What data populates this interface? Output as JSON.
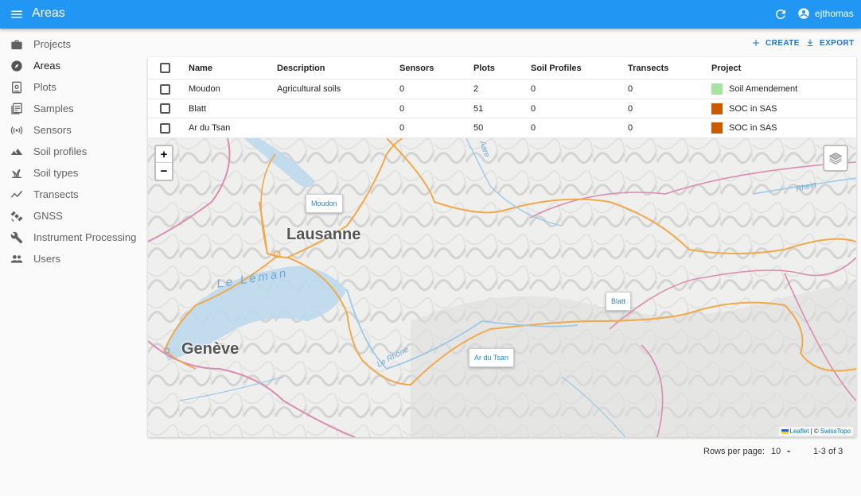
{
  "app": {
    "title": "Areas",
    "username": "ejthomas"
  },
  "sidebar": {
    "items": [
      {
        "label": "Projects",
        "icon": "briefcase-icon"
      },
      {
        "label": "Areas",
        "icon": "compass-icon",
        "active": true
      },
      {
        "label": "Plots",
        "icon": "plot-icon"
      },
      {
        "label": "Samples",
        "icon": "samples-icon"
      },
      {
        "label": "Sensors",
        "icon": "sensor-icon"
      },
      {
        "label": "Soil profiles",
        "icon": "terrain-icon"
      },
      {
        "label": "Soil types",
        "icon": "grass-icon"
      },
      {
        "label": "Transects",
        "icon": "timeline-icon"
      },
      {
        "label": "GNSS",
        "icon": "satellite-icon"
      },
      {
        "label": "Instrument Processing",
        "icon": "wrench-icon"
      },
      {
        "label": "Users",
        "icon": "people-icon"
      }
    ]
  },
  "toolbar": {
    "create_label": "CREATE",
    "export_label": "EXPORT"
  },
  "table": {
    "columns": [
      "Name",
      "Description",
      "Sensors",
      "Plots",
      "Soil Profiles",
      "Transects",
      "Project"
    ],
    "rows": [
      {
        "name": "Moudon",
        "description": "Agricultural soils",
        "sensors": "0",
        "plots": "2",
        "soil_profiles": "0",
        "transects": "0",
        "project": "Soil Amendement",
        "project_color": "#a5e3a0"
      },
      {
        "name": "Blatt",
        "description": "",
        "sensors": "0",
        "plots": "51",
        "soil_profiles": "0",
        "transects": "0",
        "project": "SOC in SAS",
        "project_color": "#c95a00"
      },
      {
        "name": "Ar du Tsan",
        "description": "",
        "sensors": "0",
        "plots": "50",
        "soil_profiles": "0",
        "transects": "0",
        "project": "SOC in SAS",
        "project_color": "#c95a00"
      }
    ]
  },
  "map": {
    "zoom_in": "+",
    "zoom_out": "−",
    "cities": [
      "Lausanne",
      "Genève"
    ],
    "lake": "Le Léman",
    "rivers": [
      "Le Rhône",
      "Aare",
      "Rhein"
    ],
    "markers": [
      "Moudon",
      "Blatt",
      "Ar du Tsan"
    ],
    "attribution_leaflet": "Leaflet",
    "attribution_sep": "| ©",
    "attribution_provider": "SwissTopo"
  },
  "pagination": {
    "rows_per_page_label": "Rows per page:",
    "rows_per_page_value": "10",
    "range": "1-3 of 3"
  },
  "colors": {
    "appbar": "#2196f3",
    "accent": "#1976d2",
    "road": "#f0a94a",
    "border": "#d98cb0",
    "water": "#9cc9e6"
  }
}
